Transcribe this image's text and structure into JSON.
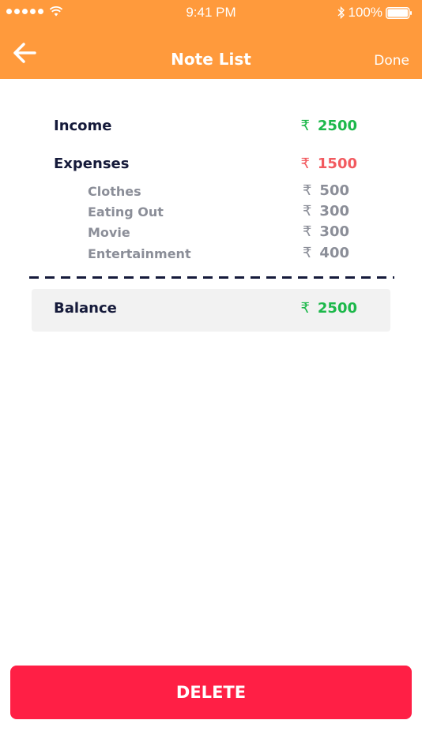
{
  "status_bar": {
    "time": "9:41 PM",
    "battery": "100%"
  },
  "nav": {
    "title": "Note List",
    "done_label": "Done",
    "back_icon": "arrow-left-icon"
  },
  "income": {
    "label": "Income",
    "currency": "₹",
    "amount": "2500"
  },
  "expenses": {
    "label": "Expenses",
    "currency": "₹",
    "amount": "1500",
    "items": [
      {
        "label": "Clothes",
        "currency": "₹",
        "amount": "500"
      },
      {
        "label": "Eating Out",
        "currency": "₹",
        "amount": "300"
      },
      {
        "label": "Movie",
        "currency": "₹",
        "amount": "300"
      },
      {
        "label": "Entertainment",
        "currency": "₹",
        "amount": "400"
      }
    ]
  },
  "balance": {
    "label": "Balance",
    "currency": "₹",
    "amount": "2500"
  },
  "delete_label": "DELETE",
  "colors": {
    "header": "#ff9a3c",
    "positive": "#1cb84a",
    "negative": "#f25a5f",
    "delete": "#ff1f45"
  }
}
